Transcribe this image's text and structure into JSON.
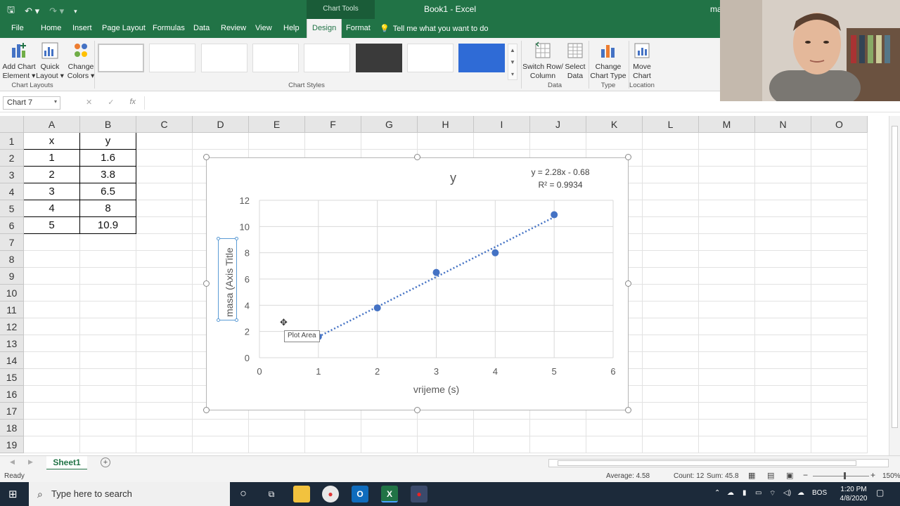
{
  "titlebar": {
    "context_group": "Chart Tools",
    "doc_title": "Book1 - Excel",
    "user_name": "ma"
  },
  "tabs": [
    "File",
    "Home",
    "Insert",
    "Page Layout",
    "Formulas",
    "Data",
    "Review",
    "View",
    "Help",
    "Design",
    "Format"
  ],
  "tell_me": "Tell me what you want to do",
  "ribbon": {
    "add_chart_element": [
      "Add Chart",
      "Element ▾"
    ],
    "quick_layout": [
      "Quick",
      "Layout ▾"
    ],
    "change_colors": [
      "Change",
      "Colors ▾"
    ],
    "chart_layouts_label": "Chart Layouts",
    "chart_styles_label": "Chart Styles",
    "switch_row_col": [
      "Switch Row/",
      "Column"
    ],
    "select_data": [
      "Select",
      "Data"
    ],
    "data_label": "Data",
    "change_chart_type": [
      "Change",
      "Chart Type"
    ],
    "type_label": "Type",
    "move_chart": [
      "Move",
      "Chart"
    ],
    "location_label": "Location"
  },
  "formula_bar": {
    "name_box": "Chart 7",
    "fx": "fx"
  },
  "columns": [
    "A",
    "B",
    "C",
    "D",
    "E",
    "F",
    "G",
    "H",
    "I",
    "J",
    "K",
    "L",
    "M",
    "N",
    "O"
  ],
  "rows": [
    "1",
    "2",
    "3",
    "4",
    "5",
    "6",
    "7",
    "8",
    "9",
    "10",
    "11",
    "12",
    "13",
    "14",
    "15",
    "16",
    "17",
    "18",
    "19"
  ],
  "cells": {
    "A1": "x",
    "B1": "y",
    "A2": "1",
    "B2": "1.6",
    "A3": "2",
    "B3": "3.8",
    "A4": "3",
    "B4": "6.5",
    "A5": "4",
    "B5": "8",
    "A6": "5",
    "B6": "10.9"
  },
  "chart_data": {
    "type": "scatter",
    "title": "y",
    "xlabel": "vrijeme (s)",
    "ylabel": "masa (Axis Title",
    "xlim": [
      0,
      6
    ],
    "ylim": [
      0,
      12
    ],
    "x_ticks": [
      "0",
      "1",
      "2",
      "3",
      "4",
      "5",
      "6"
    ],
    "y_ticks": [
      "0",
      "2",
      "4",
      "6",
      "8",
      "10",
      "12"
    ],
    "grid": true,
    "series": [
      {
        "x": [
          1,
          2,
          3,
          4,
          5
        ],
        "y": [
          1.6,
          3.8,
          6.5,
          8,
          10.9
        ],
        "color": "#4472c4",
        "trendline": {
          "type": "linear",
          "slope": 2.28,
          "intercept": -0.68,
          "style": "dotted"
        }
      }
    ],
    "annotations": [
      "y = 2.28x - 0.68",
      "R² = 0.9934"
    ]
  },
  "tooltip": "Plot Area",
  "sheet_tab": "Sheet1",
  "status": {
    "ready": "Ready",
    "average": "Average: 4.58",
    "count": "Count: 12",
    "sum": "Sum: 45.8",
    "zoom": "150%"
  },
  "taskbar": {
    "search_placeholder": "Type here to search",
    "lang": "BOS",
    "time": "1:20 PM",
    "date": "4/8/2020"
  },
  "colors": {
    "excel_green": "#217346",
    "marker_blue": "#4472c4"
  }
}
